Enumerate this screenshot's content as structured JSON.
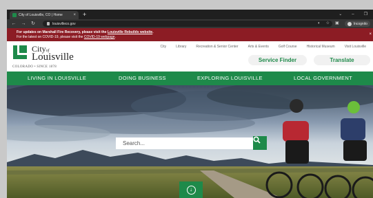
{
  "browser": {
    "tab_title": "City of Louisville, CO | Home",
    "tab_close": "×",
    "new_tab": "+",
    "url": "louisvilleco.gov",
    "incognito_label": "Incognito",
    "window_controls": [
      "⌄",
      "–",
      "❐"
    ]
  },
  "alert": {
    "line1_prefix": "For updates on Marshall Fire Recovery, please visit the ",
    "line1_link": "Louisville Rebuilds website",
    "line1_suffix": ".",
    "line2_prefix": "For the latest on COVID-19, please visit the ",
    "line2_link": "COVID-19 webpage",
    "line2_suffix": ".",
    "close": "×"
  },
  "logo": {
    "city": "City",
    "of": "of",
    "name": "Louisville",
    "tagline": "COLORADO • SINCE 1878"
  },
  "top_links": [
    "City",
    "Library",
    "Recreation & Senior Center",
    "Arts & Events",
    "Golf Course",
    "Historical Museum",
    "Visit Louisville"
  ],
  "header_buttons": {
    "service_finder": "Service Finder",
    "translate": "Translate"
  },
  "main_nav": [
    "LIVING IN LOUISVILLE",
    "DOING BUSINESS",
    "EXPLORING LOUISVILLE",
    "LOCAL GOVERNMENT"
  ],
  "search": {
    "placeholder": "Search..."
  },
  "colors": {
    "brand_green": "#1e8a4a",
    "alert_red": "#8c1c24"
  },
  "icons": {
    "search": "search-icon",
    "scroll_down": "arrow-down-icon"
  }
}
